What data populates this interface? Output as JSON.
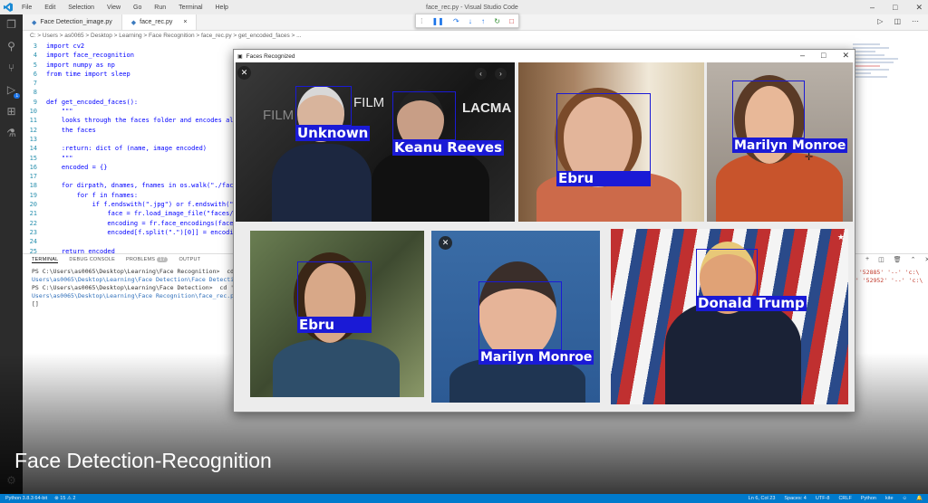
{
  "titlebar": {
    "menu": [
      "File",
      "Edit",
      "Selection",
      "View",
      "Go",
      "Run",
      "Terminal",
      "Help"
    ],
    "title": "face_rec.py - Visual Studio Code"
  },
  "tabs": [
    {
      "label": "Face Detection_image.py"
    },
    {
      "label": "face_rec.py",
      "close": "×"
    }
  ],
  "breadcrumb": "C: > Users > as0065 > Desktop > Learning > Face Recognition > face_rec.py > get_encoded_faces > ...",
  "code": [
    {
      "n": "3",
      "t": "import cv2"
    },
    {
      "n": "4",
      "t": "import face_recognition"
    },
    {
      "n": "5",
      "t": "import numpy as np"
    },
    {
      "n": "6",
      "t": "from time import sleep"
    },
    {
      "n": "7",
      "t": ""
    },
    {
      "n": "8",
      "t": ""
    },
    {
      "n": "9",
      "t": "def get_encoded_faces():"
    },
    {
      "n": "10",
      "t": "    \"\"\""
    },
    {
      "n": "11",
      "t": "    looks through the faces folder and encodes all"
    },
    {
      "n": "12",
      "t": "    the faces"
    },
    {
      "n": "13",
      "t": ""
    },
    {
      "n": "14",
      "t": "    :return: dict of (name, image encoded)"
    },
    {
      "n": "15",
      "t": "    \"\"\""
    },
    {
      "n": "16",
      "t": "    encoded = {}"
    },
    {
      "n": "17",
      "t": ""
    },
    {
      "n": "18",
      "t": "    for dirpath, dnames, fnames in os.walk(\"./faces\"):"
    },
    {
      "n": "19",
      "t": "        for f in fnames:"
    },
    {
      "n": "20",
      "t": "            if f.endswith(\".jpg\") or f.endswith(\".png\"):"
    },
    {
      "n": "21",
      "t": "                face = fr.load_image_file(\"faces/\" + f)"
    },
    {
      "n": "22",
      "t": "                encoding = fr.face_encodings(face)[0]"
    },
    {
      "n": "23",
      "t": "                encoded[f.split(\".\")[0]] = encoding"
    },
    {
      "n": "24",
      "t": ""
    },
    {
      "n": "25",
      "t": "    return encoded"
    },
    {
      "n": "26",
      "t": ""
    }
  ],
  "panel": {
    "tabs": [
      "TERMINAL",
      "DEBUG CONSOLE",
      "PROBLEMS",
      "OUTPUT"
    ],
    "problems_count": "17",
    "lines": [
      "PS C:\\Users\\as0065\\Desktop\\Learning\\Face Recognition>  cd 'c:\\",
      "Users\\as0065\\Desktop\\Learning\\Face Detection\\Face Detection",
      "PS C:\\Users\\as0065\\Desktop\\Learning\\Face Detection>  cd 'c:\\",
      "Users\\as0065\\Desktop\\Learning\\Face Recognition\\face_rec.py'",
      "[]"
    ],
    "right_lines": [
      "' '52885' '--' 'c:\\",
      "",
      "",
      " ' '52952' '--' 'c:\\"
    ]
  },
  "popup": {
    "title": "Faces Recognized",
    "labels": [
      "Unknown",
      "Keanu Reeves",
      "Ebru",
      "Marilyn Monroe",
      "Ebru",
      "Marilyn Monroe",
      "Donald Trump"
    ],
    "photo_text": [
      "FILM",
      "LACMA",
      "FILM"
    ]
  },
  "caption": "Face Detection-Recognition",
  "status": {
    "python": "Python 3.8.3 64-bit",
    "errors": "⊗ 15 ⚠ 2",
    "ln": "Ln 6, Col 23",
    "spaces": "Spaces: 4",
    "enc": "UTF-8",
    "eol": "CRLF",
    "lang": "Python",
    "user": "kite"
  },
  "colors": {
    "accent": "#007acc",
    "box": "#1a1ad6"
  }
}
